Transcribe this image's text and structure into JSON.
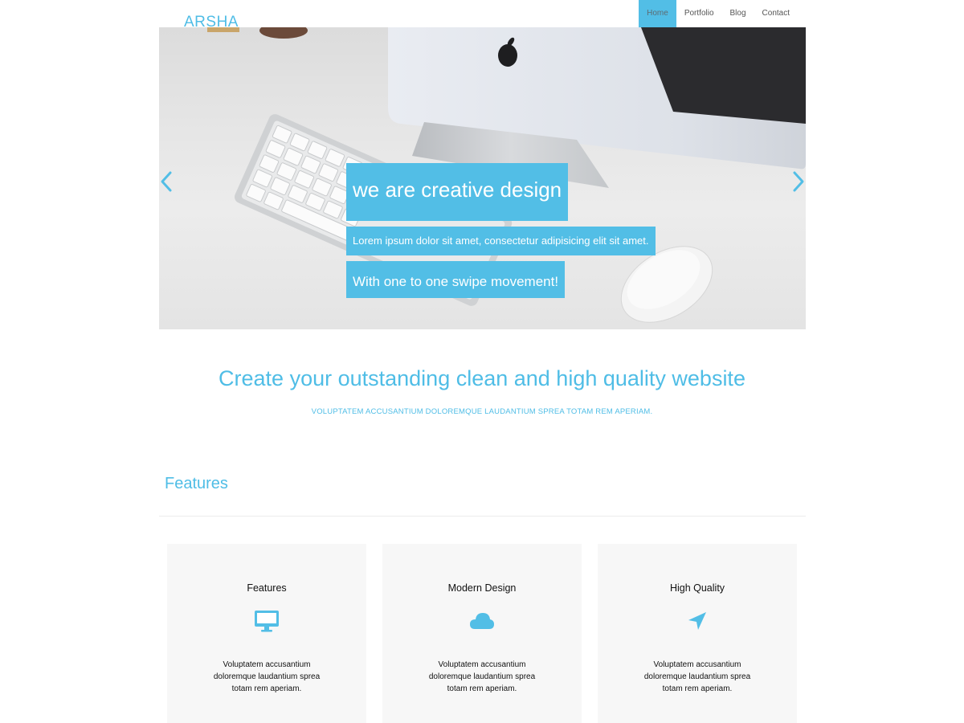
{
  "header": {
    "logo": "ARSHA",
    "nav": [
      "Home",
      "Portfolio",
      "Blog",
      "Contact"
    ],
    "active_nav": "Home"
  },
  "hero": {
    "caption_title": "we are creative design",
    "caption_text": "Lorem ipsum dolor sit amet, consectetur adipisicing elit sit amet.",
    "caption_action": "With one to one swipe movement!",
    "prev_icon": "chevron-left-icon",
    "next_icon": "chevron-right-icon"
  },
  "intro": {
    "title": "Create your outstanding clean and high quality website",
    "subtitle": "VOLUPTATEM ACCUSANTIUM DOLOREMQUE LAUDANTIUM SPREA TOTAM REM APERIAM."
  },
  "features": {
    "heading": "Features",
    "cards": [
      {
        "title": "Features",
        "icon": "monitor-icon",
        "text": "Voluptatem accusantium doloremque laudantium sprea totam rem aperiam."
      },
      {
        "title": "Modern Design",
        "icon": "cloud-icon",
        "text": "Voluptatem accusantium doloremque laudantium sprea totam rem aperiam."
      },
      {
        "title": "High Quality",
        "icon": "location-arrow-icon",
        "text": "Voluptatem accusantium doloremque laudantium sprea totam rem aperiam."
      }
    ]
  },
  "colors": {
    "accent": "#52bee6",
    "card_bg": "#f7f7f7"
  }
}
